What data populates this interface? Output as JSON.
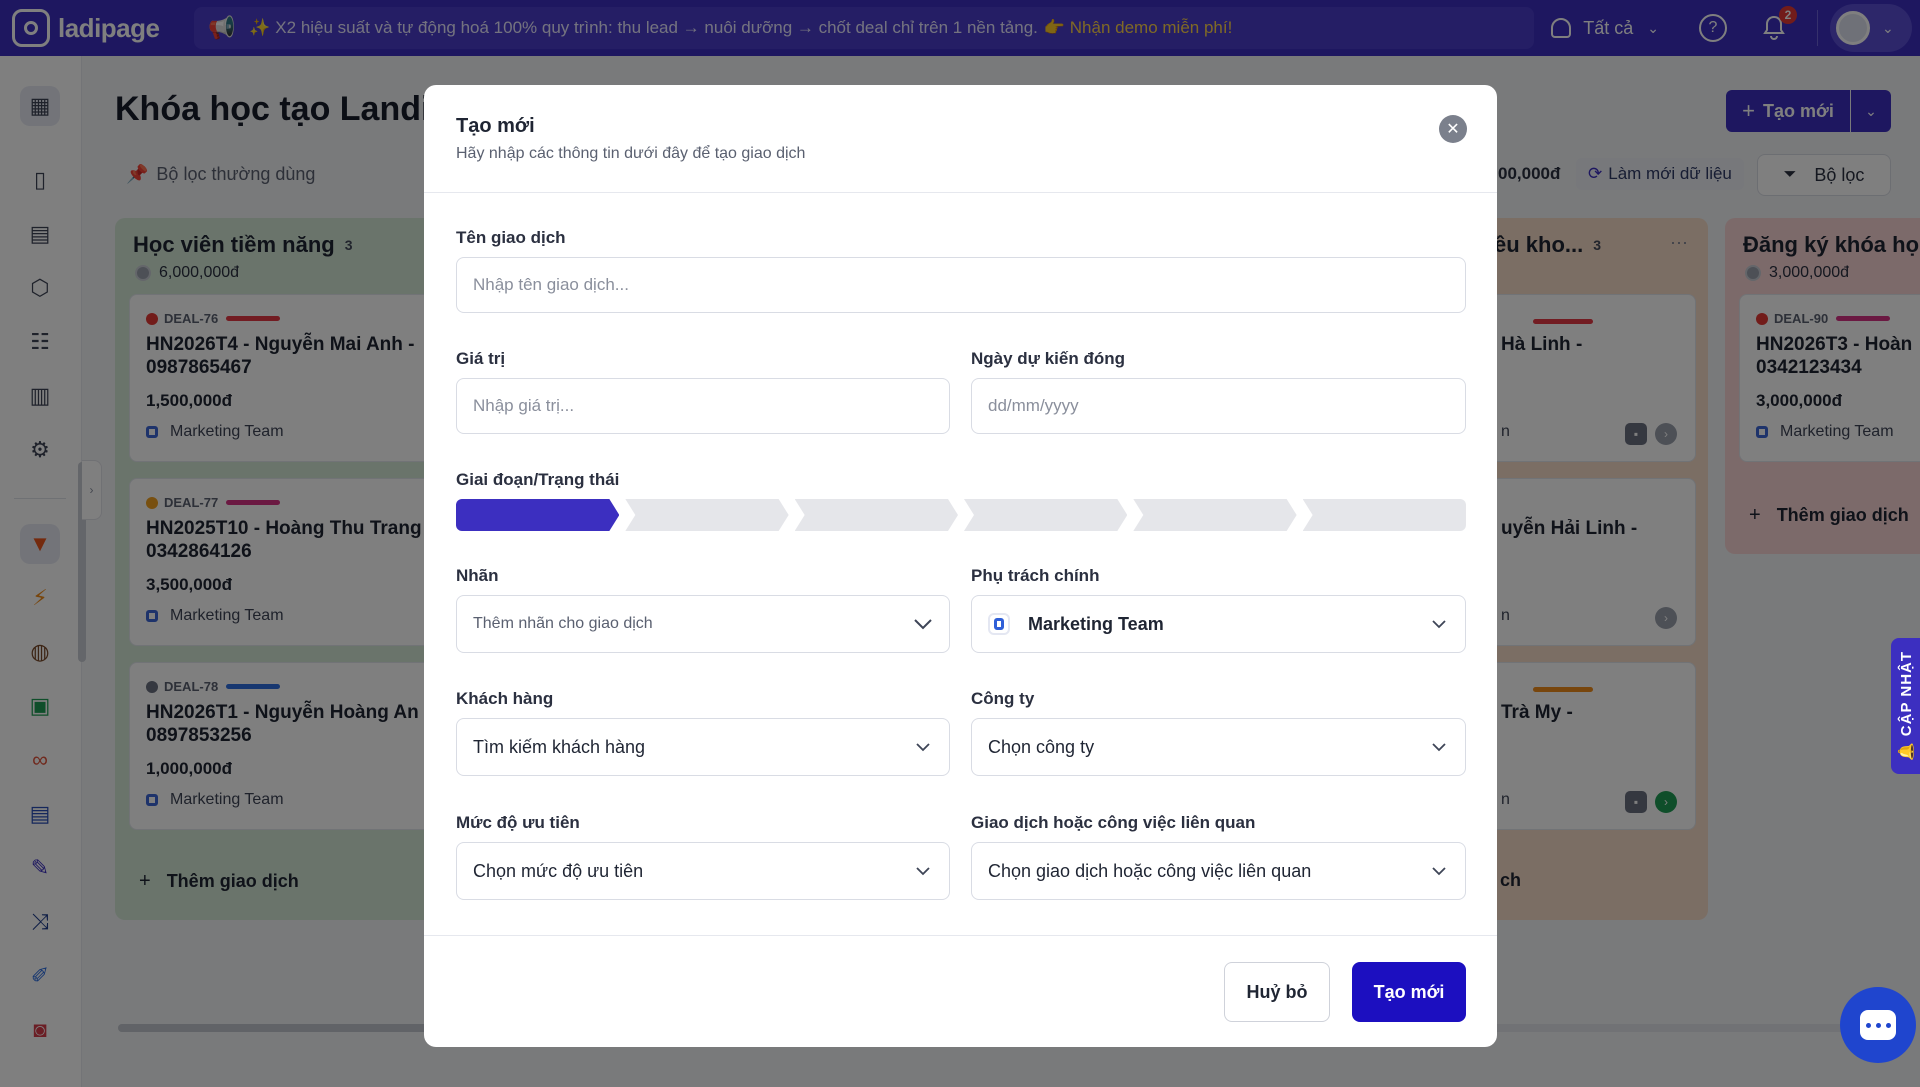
{
  "topbar": {
    "logo_text": "ladipage",
    "announcement": "✨ X2 hiệu suất và tự động hoá 100% quy trình: thu lead → nuôi dưỡng → chốt deal chỉ trên 1 nền tảng.",
    "announcement_cta": "👉 Nhận demo miễn phí!",
    "filter_label": "Tất cả",
    "notification_count": "2"
  },
  "sidebar": {
    "items": [
      "building-icon",
      "book-icon",
      "inbox-icon",
      "box-icon",
      "contacts-icon",
      "report-icon",
      "settings-icon",
      "funnel-icon",
      "flash-icon",
      "globe-icon",
      "store-icon",
      "link-icon",
      "page-icon",
      "form-icon",
      "shuffle-icon",
      "edit-icon",
      "survey-icon"
    ]
  },
  "main": {
    "page_title": "Khóa học tạo Landin",
    "create_button": "Tạo mới",
    "favorite_filters": "Bộ lọc thường dùng",
    "total_value": "00,000đ",
    "refresh_label": "Làm mới dữ liệu",
    "filter_label": "Bộ lọc"
  },
  "columns": [
    {
      "title": "Học viên tiềm năng",
      "count": "3",
      "sum": "6,000,000đ",
      "add_label": "Thêm giao dịch",
      "cards": [
        {
          "id": "DEAL-76",
          "dot_color": "#e53935",
          "bar_color": "#e53945",
          "name": "HN2026T4 - Nguyễn Mai Anh - 0987865467",
          "value": "1,500,000đ",
          "owner": "Marketing Team"
        },
        {
          "id": "DEAL-77",
          "dot_color": "#f0a020",
          "bar_color": "#d63384",
          "name": "HN2025T10 - Hoàng Thu Trang 0342864126",
          "value": "3,500,000đ",
          "owner": "Marketing Team"
        },
        {
          "id": "DEAL-78",
          "dot_color": "#6b7080",
          "bar_color": "#2f6fe0",
          "name": "HN2026T1 - Nguyễn Hoàng An 0897853256",
          "value": "1,000,000đ",
          "owner": "Marketing Team"
        }
      ]
    },
    {
      "title": "ều kho...",
      "count": "3",
      "card_fragments": [
        "Hà Linh -",
        "uyễn Hải Linh -",
        "Trà My -"
      ],
      "owner_fragments": [
        "n",
        "n",
        "n"
      ],
      "add_fragment": "ch"
    },
    {
      "title": "Đăng ký khóa họ",
      "sum": "3,000,000đ",
      "add_label": "Thêm giao dịch",
      "card": {
        "id": "DEAL-90",
        "dot_color": "#e53935",
        "bar_color": "#d63384",
        "name": "HN2026T3 - Hoàn 0342123434",
        "value": "3,000,000đ",
        "owner": "Marketing Team"
      }
    }
  ],
  "side_tab": "🔔 CẬP NHẬT",
  "modal": {
    "title": "Tạo mới",
    "subtitle": "Hãy nhập các thông tin dưới đây để tạo giao dịch",
    "fields": {
      "deal_name": {
        "label": "Tên giao dịch",
        "placeholder": "Nhập tên giao dịch..."
      },
      "value": {
        "label": "Giá trị",
        "placeholder": "Nhập giá trị..."
      },
      "close_date": {
        "label": "Ngày dự kiến đóng",
        "placeholder": "dd/mm/yyyy"
      },
      "stage": {
        "label": "Giai đoạn/Trạng thái",
        "stages_total": 6,
        "active_index": 0
      },
      "tags": {
        "label": "Nhãn",
        "placeholder": "Thêm nhãn cho giao dịch"
      },
      "owner": {
        "label": "Phụ trách chính",
        "value": "Marketing Team"
      },
      "customer": {
        "label": "Khách hàng",
        "value": "Tìm kiếm khách hàng"
      },
      "company": {
        "label": "Công ty",
        "value": "Chọn công ty"
      },
      "priority": {
        "label": "Mức độ ưu tiên",
        "value": "Chọn mức độ ưu tiên"
      },
      "related": {
        "label": "Giao dịch hoặc công việc liên quan",
        "value": "Chọn giao dịch hoặc công việc liên quan"
      }
    },
    "cancel_label": "Huỷ bỏ",
    "submit_label": "Tạo mới"
  }
}
